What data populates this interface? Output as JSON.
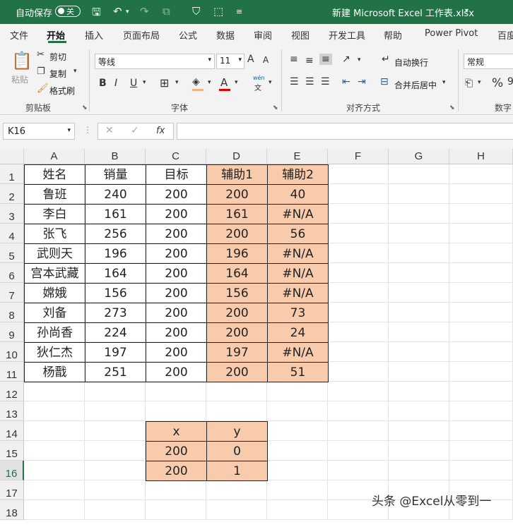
{
  "titlebar": {
    "autosave_label": "自动保存",
    "autosave_state": "关",
    "filename": "新建 Microsoft Excel 工作表.xlsx",
    "filename_caret": "▾"
  },
  "menu": {
    "tabs": [
      "文件",
      "开始",
      "插入",
      "页面布局",
      "公式",
      "数据",
      "审阅",
      "视图",
      "开发工具",
      "帮助",
      "Power Pivot",
      "百度"
    ],
    "active": "开始"
  },
  "ribbon": {
    "clipboard": {
      "paste": "粘贴",
      "cut": "剪切",
      "copy": "复制",
      "format_painter": "格式刷",
      "group_label": "剪贴板"
    },
    "font": {
      "name": "等线",
      "size": "11",
      "bold": "B",
      "italic": "I",
      "underline": "U",
      "group_label": "字体",
      "grow": "A",
      "shrink": "A",
      "phonetic_top": "wén",
      "phonetic_bottom": "文"
    },
    "alignment": {
      "wrap_text": "自动换行",
      "merge_center": "合并后居中",
      "group_label": "对齐方式"
    },
    "number": {
      "format": "常规",
      "percent": "%",
      "group_label": "数字"
    }
  },
  "formula_bar": {
    "name_box": "K16",
    "fx": "fx",
    "formula": ""
  },
  "columns": [
    "A",
    "B",
    "C",
    "D",
    "E",
    "F",
    "G",
    "H"
  ],
  "rows": [
    "1",
    "2",
    "3",
    "4",
    "5",
    "6",
    "7",
    "8",
    "9",
    "10",
    "11",
    "12",
    "13",
    "14",
    "15",
    "16",
    "17",
    "18"
  ],
  "selected_row": "16",
  "table": {
    "headers": [
      "姓名",
      "销量",
      "目标",
      "辅助1",
      "辅助2"
    ],
    "rows": [
      [
        "鲁班",
        "240",
        "200",
        "200",
        "40"
      ],
      [
        "李白",
        "161",
        "200",
        "161",
        "#N/A"
      ],
      [
        "张飞",
        "256",
        "200",
        "200",
        "56"
      ],
      [
        "武则天",
        "196",
        "200",
        "196",
        "#N/A"
      ],
      [
        "宫本武藏",
        "164",
        "200",
        "164",
        "#N/A"
      ],
      [
        "嫦娥",
        "156",
        "200",
        "156",
        "#N/A"
      ],
      [
        "刘备",
        "273",
        "200",
        "200",
        "73"
      ],
      [
        "孙尚香",
        "224",
        "200",
        "200",
        "24"
      ],
      [
        "狄仁杰",
        "197",
        "200",
        "197",
        "#N/A"
      ],
      [
        "杨戬",
        "251",
        "200",
        "200",
        "51"
      ]
    ]
  },
  "xy_table": {
    "headers": [
      "x",
      "y"
    ],
    "rows": [
      [
        "200",
        "0"
      ],
      [
        "200",
        "1"
      ]
    ]
  },
  "watermark": "头条 @Excel从零到一",
  "colors": {
    "accent": "#217346",
    "highlight": "#f8cbad"
  }
}
